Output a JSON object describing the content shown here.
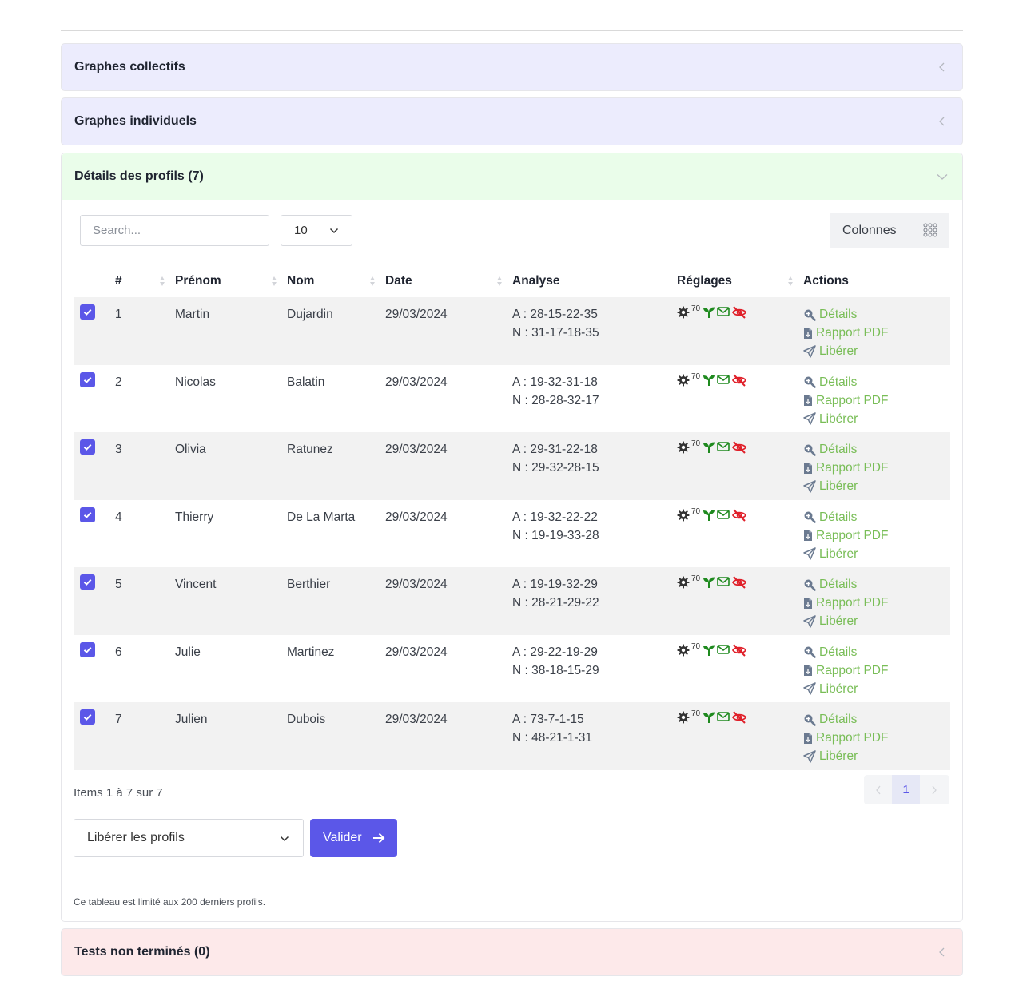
{
  "panels": {
    "collectifs": {
      "title": "Graphes collectifs"
    },
    "individuels": {
      "title": "Graphes individuels"
    },
    "details": {
      "title": "Détails des profils (7)"
    },
    "tests": {
      "title": "Tests non terminés (0)"
    }
  },
  "toolbar": {
    "search_placeholder": "Search...",
    "page_size": "10",
    "columns_label": "Colonnes"
  },
  "table": {
    "headers": [
      "#",
      "Prénom",
      "Nom",
      "Date",
      "Analyse",
      "Réglages",
      "Actions"
    ],
    "rows": [
      {
        "num": "1",
        "prenom": "Martin",
        "nom": "Dujardin",
        "date": "29/03/2024",
        "a": "A : 28-15-22-35",
        "n": "N : 31-17-18-35",
        "setting": "70"
      },
      {
        "num": "2",
        "prenom": "Nicolas",
        "nom": "Balatin",
        "date": "29/03/2024",
        "a": "A : 19-32-31-18",
        "n": "N : 28-28-32-17",
        "setting": "70"
      },
      {
        "num": "3",
        "prenom": "Olivia",
        "nom": "Ratunez",
        "date": "29/03/2024",
        "a": "A : 29-31-22-18",
        "n": "N : 29-32-28-15",
        "setting": "70"
      },
      {
        "num": "4",
        "prenom": "Thierry",
        "nom": "De La Marta",
        "date": "29/03/2024",
        "a": "A : 19-32-22-22",
        "n": "N : 19-19-33-28",
        "setting": "70"
      },
      {
        "num": "5",
        "prenom": "Vincent",
        "nom": "Berthier",
        "date": "29/03/2024",
        "a": "A : 19-19-32-29",
        "n": "N : 28-21-29-22",
        "setting": "70"
      },
      {
        "num": "6",
        "prenom": "Julie",
        "nom": "Martinez",
        "date": "29/03/2024",
        "a": "A : 29-22-19-29",
        "n": "N : 38-18-15-29",
        "setting": "70"
      },
      {
        "num": "7",
        "prenom": "Julien",
        "nom": "Dubois",
        "date": "29/03/2024",
        "a": "A : 73-7-1-15",
        "n": "N : 48-21-1-31",
        "setting": "70"
      }
    ],
    "actions": {
      "details": "Détails",
      "pdf": "Rapport PDF",
      "liberer": "Libérer"
    }
  },
  "footer": {
    "items_info": "Items 1 à 7 sur 7",
    "current_page": "1",
    "bulk_action": "Libérer les profils",
    "validate_label": "Valider",
    "footnote": "Ce tableau est limité aux 200 derniers profils."
  },
  "colors": {
    "accent": "#5b57e8",
    "action_green": "#78bd56",
    "icon_green": "#1f8a1f",
    "icon_red": "#e0202a",
    "panel_purple": "#ececfd",
    "panel_green": "#eafdea",
    "panel_red": "#fde9ea"
  },
  "icons": {
    "checkbox": "check-icon",
    "settings": [
      "gear-icon",
      "sprout-icon",
      "envelope-icon",
      "eye-slash-icon"
    ],
    "actions": [
      "magnifier-plus-icon",
      "file-pdf-icon",
      "paper-plane-icon"
    ],
    "columns": "grid-icon"
  }
}
